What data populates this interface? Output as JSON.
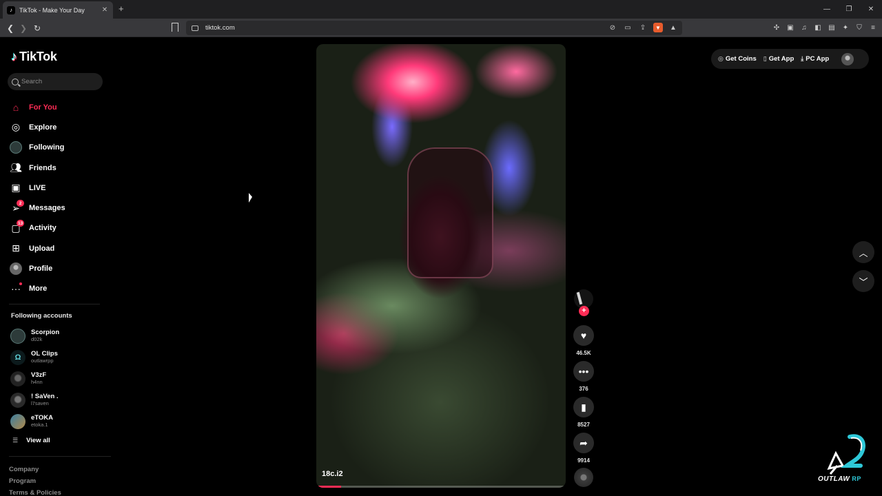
{
  "browser": {
    "tab_title": "TikTok - Make Your Day",
    "url": "tikt​ok.com"
  },
  "tiktok": {
    "logo_text": "TikTok",
    "search_placeholder": "Search",
    "nav": [
      {
        "label": "For You",
        "active": true
      },
      {
        "label": "Explore"
      },
      {
        "label": "Following"
      },
      {
        "label": "Friends"
      },
      {
        "label": "LIVE"
      },
      {
        "label": "Messages",
        "badge": "2"
      },
      {
        "label": "Activity",
        "badge": "13"
      },
      {
        "label": "Upload"
      },
      {
        "label": "Profile"
      },
      {
        "label": "More"
      }
    ],
    "following_title": "Following accounts",
    "accounts": [
      {
        "name": "Scorpion",
        "handle": "d02k"
      },
      {
        "name": "OL Clips",
        "handle": "outlawrpp"
      },
      {
        "name": "V3zF",
        "handle": "h4nn"
      },
      {
        "name": "! SaVen .",
        "handle": "l7saven"
      },
      {
        "name": "eTOKA",
        "handle": "etoka.1"
      }
    ],
    "view_all": "View all",
    "footer": [
      "Company",
      "Program",
      "Terms & Policies"
    ],
    "top_actions": {
      "get_coins": "Get Coins",
      "get_app": "Get App",
      "pc_app": "PC App"
    },
    "video": {
      "caption": "18c.i2",
      "progress": 0.1
    },
    "actions": {
      "likes": "46.5K",
      "comments": "376",
      "saves": "8527",
      "shares": "9914"
    }
  },
  "watermark": {
    "text": "OUTLAW",
    "suffix": "RP"
  },
  "colors": {
    "accent": "#fe2c55",
    "background": "#000000",
    "watermark_accent": "#2ec8d8"
  }
}
